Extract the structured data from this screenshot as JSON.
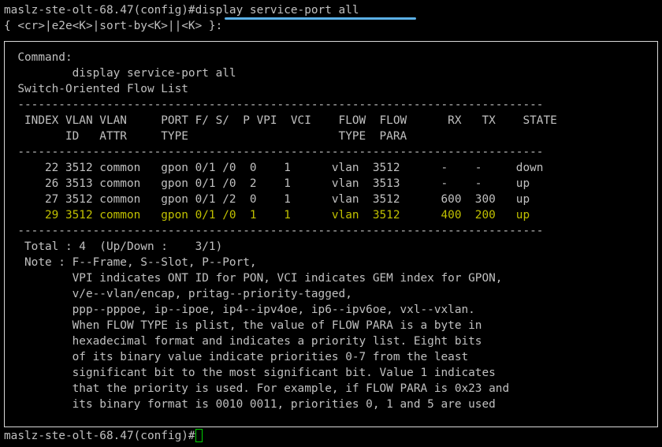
{
  "command_prompt": "maslz-ste-olt-68.47(config)#",
  "command_text": "display service-port all",
  "options_hint": "{ <cr>|e2e<K>|sort-by<K>||<K> }:",
  "command_label": "  Command:",
  "command_echo": "          display service-port all",
  "list_title": "  Switch-Oriented Flow List",
  "separator": "  -----------------------------------------------------------------------------",
  "header_line_1": "   INDEX VLAN VLAN     PORT F/ S/  P VPI  VCI    FLOW  FLOW      RX   TX    STATE",
  "header_line_2": "         ID   ATTR     TYPE                      TYPE  PARA",
  "rows": [
    "      22 3512 common   gpon 0/1 /0  0    1      vlan  3512      -    -     down",
    "      26 3513 common   gpon 0/1 /0  2    1      vlan  3513      -    -     up",
    "      27 3512 common   gpon 0/1 /2  0    1      vlan  3512      600  300   up",
    "      29 3512 common   gpon 0/1 /0  1    1      vlan  3512      400  200   up"
  ],
  "total_line": "   Total : 4  (Up/Down :    3/1)",
  "notes": [
    "   Note : F--Frame, S--Slot, P--Port,",
    "          VPI indicates ONT ID for PON, VCI indicates GEM index for GPON,",
    "          v/e--vlan/encap, pritag--priority-tagged,",
    "          ppp--pppoe, ip--ipoe, ip4--ipv4oe, ip6--ipv6oe, vxl--vxlan.",
    "          When FLOW TYPE is plist, the value of FLOW PARA is a byte in",
    "          hexadecimal format and indicates a priority list. Eight bits",
    "          of its binary value indicate priorities 0-7 from the least",
    "          significant bit to the most significant bit. Value 1 indicates",
    "          that the priority is used. For example, if FLOW PARA is 0x23 and",
    "          its binary format is 0010 0011, priorities 0, 1 and 5 are used"
  ],
  "final_prompt": "maslz-ste-olt-68.47(config)#",
  "colors": {
    "background": "#000000",
    "text": "#c0c0c0",
    "highlight_row": "#c0c000",
    "cursor": "#00d000",
    "annotation_underline": "#5bb0e6",
    "annotation_frame": "#d8d8d8"
  }
}
